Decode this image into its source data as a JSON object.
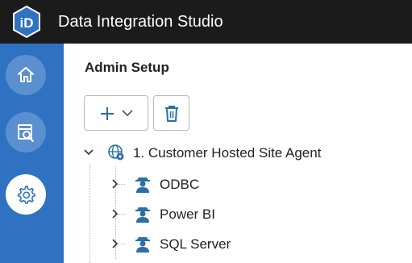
{
  "app": {
    "title": "Data Integration Studio",
    "logo_icon": "logo-icon"
  },
  "sidebar": {
    "items": [
      {
        "name": "home",
        "icon": "home-icon",
        "active": false
      },
      {
        "name": "search-report",
        "icon": "search-report-icon",
        "active": false
      },
      {
        "name": "admin",
        "icon": "gear-icon",
        "active": true
      }
    ]
  },
  "page": {
    "title": "Admin Setup"
  },
  "toolbar": {
    "add_icon": "plus-icon",
    "dropdown_icon": "chevron-down-icon",
    "delete_icon": "trash-icon"
  },
  "tree": {
    "root": {
      "label": "1. Customer Hosted Site Agent",
      "expanded": true,
      "icon": "globe-gear-icon"
    },
    "children": [
      {
        "label": "ODBC",
        "icon": "agent-icon",
        "expanded": false
      },
      {
        "label": "Power BI",
        "icon": "agent-icon",
        "expanded": false
      },
      {
        "label": "SQL Server",
        "icon": "agent-icon",
        "expanded": false
      }
    ]
  },
  "colors": {
    "topbar": "#1b1b1b",
    "sidebar": "#2f72c2",
    "accent": "#2f72c2",
    "icon_blue": "#2e6ea6"
  }
}
